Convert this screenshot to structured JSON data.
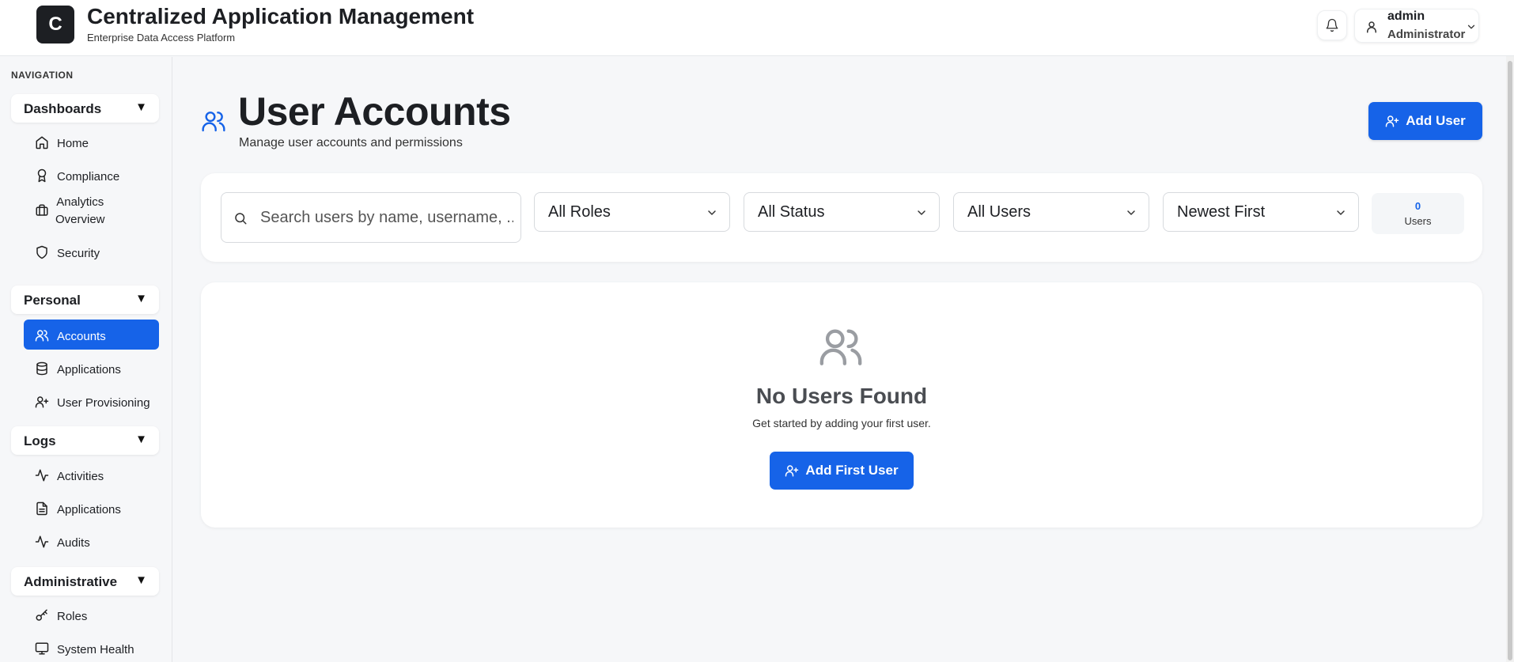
{
  "header": {
    "logo_letter": "C",
    "title": "Centralized Application Management",
    "subtitle": "Enterprise Data Access Platform",
    "user": {
      "name": "admin",
      "role": "Administrator"
    }
  },
  "sidebar": {
    "heading": "NAVIGATION",
    "groups": [
      {
        "label": "Dashboards",
        "arrow": "▼",
        "items": [
          {
            "label": "Home",
            "icon": "home-icon"
          },
          {
            "label": "Compliance",
            "icon": "award-icon"
          },
          {
            "label": "Analytics Overview",
            "line1": "Analytics",
            "line2": "Overview",
            "icon": "briefcase-icon"
          },
          {
            "label": "Security",
            "icon": "shield-icon"
          }
        ]
      },
      {
        "label": "Personal",
        "arrow": "▼",
        "items": [
          {
            "label": "Accounts",
            "icon": "users-icon",
            "active": true
          },
          {
            "label": "Applications",
            "icon": "database-icon"
          },
          {
            "label": "User Provisioning",
            "icon": "user-plus-icon"
          }
        ]
      },
      {
        "label": "Logs",
        "arrow": "▼",
        "items": [
          {
            "label": "Activities",
            "icon": "activity-icon"
          },
          {
            "label": "Applications",
            "icon": "file-text-icon"
          },
          {
            "label": "Audits",
            "icon": "activity-icon"
          }
        ]
      },
      {
        "label": "Administrative",
        "arrow": "▼",
        "items": [
          {
            "label": "Roles",
            "icon": "key-icon"
          },
          {
            "label": "System Health",
            "icon": "monitor-icon"
          }
        ]
      }
    ]
  },
  "main": {
    "title": "User Accounts",
    "subtitle": "Manage user accounts and permissions",
    "add_user_label": "Add User",
    "filters": {
      "search_placeholder": "Search users by name, username, ..",
      "role": "All Roles",
      "status": "All Status",
      "users": "All Users",
      "sort": "Newest First"
    },
    "count": {
      "value": "0",
      "label": "Users"
    },
    "empty": {
      "title": "No Users Found",
      "text": "Get started by adding your first user.",
      "button": "Add First User"
    }
  },
  "colors": {
    "accent": "#1663e8",
    "logo_bg": "#1d1f23",
    "background": "#f6f7f9"
  }
}
